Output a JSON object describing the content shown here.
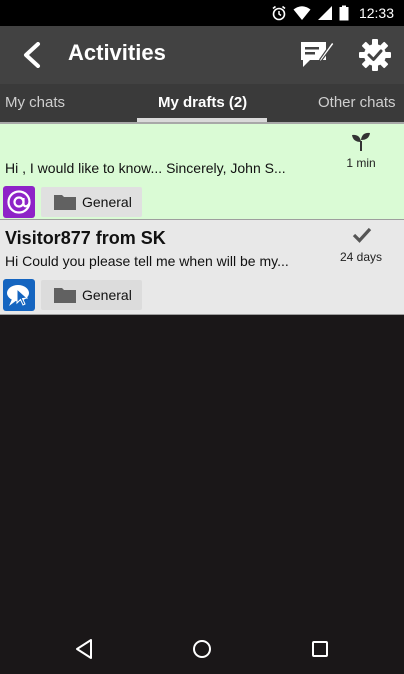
{
  "status_bar": {
    "time": "12:33",
    "icons": [
      "alarm-icon",
      "wifi-icon",
      "signal-icon",
      "battery-icon"
    ]
  },
  "action_bar": {
    "title": "Activities",
    "icons": [
      "back-arrow-icon",
      "compose-icon",
      "settings-gear-icon"
    ]
  },
  "tabs": [
    {
      "label": "My chats",
      "selected": false
    },
    {
      "label": "My drafts (2)",
      "selected": true
    },
    {
      "label": "Other chats",
      "selected": false
    }
  ],
  "items": [
    {
      "title": "",
      "preview": "Hi ,  I would like to know...  Sincerely, John S...",
      "time": "1 min",
      "status_icon": "sprout-icon",
      "channel_icon": "email-at-icon",
      "folder": "General",
      "background": "#dafbd5"
    },
    {
      "title": "Visitor877 from SK",
      "preview": "Hi Could you please tell me when will be my...",
      "time": "24 days",
      "status_icon": "checkmark-icon",
      "channel_icon": "chat-bubble-icon",
      "folder": "General",
      "background": "#e8e8e8"
    }
  ],
  "nav_bar": {
    "icons": [
      "nav-back-icon",
      "nav-home-icon",
      "nav-recent-icon"
    ]
  },
  "colors": {
    "action_bar": "#424242",
    "tab_bar": "#3a3a3a",
    "email_channel": "#8e24c7",
    "chat_channel": "#1565c0"
  }
}
